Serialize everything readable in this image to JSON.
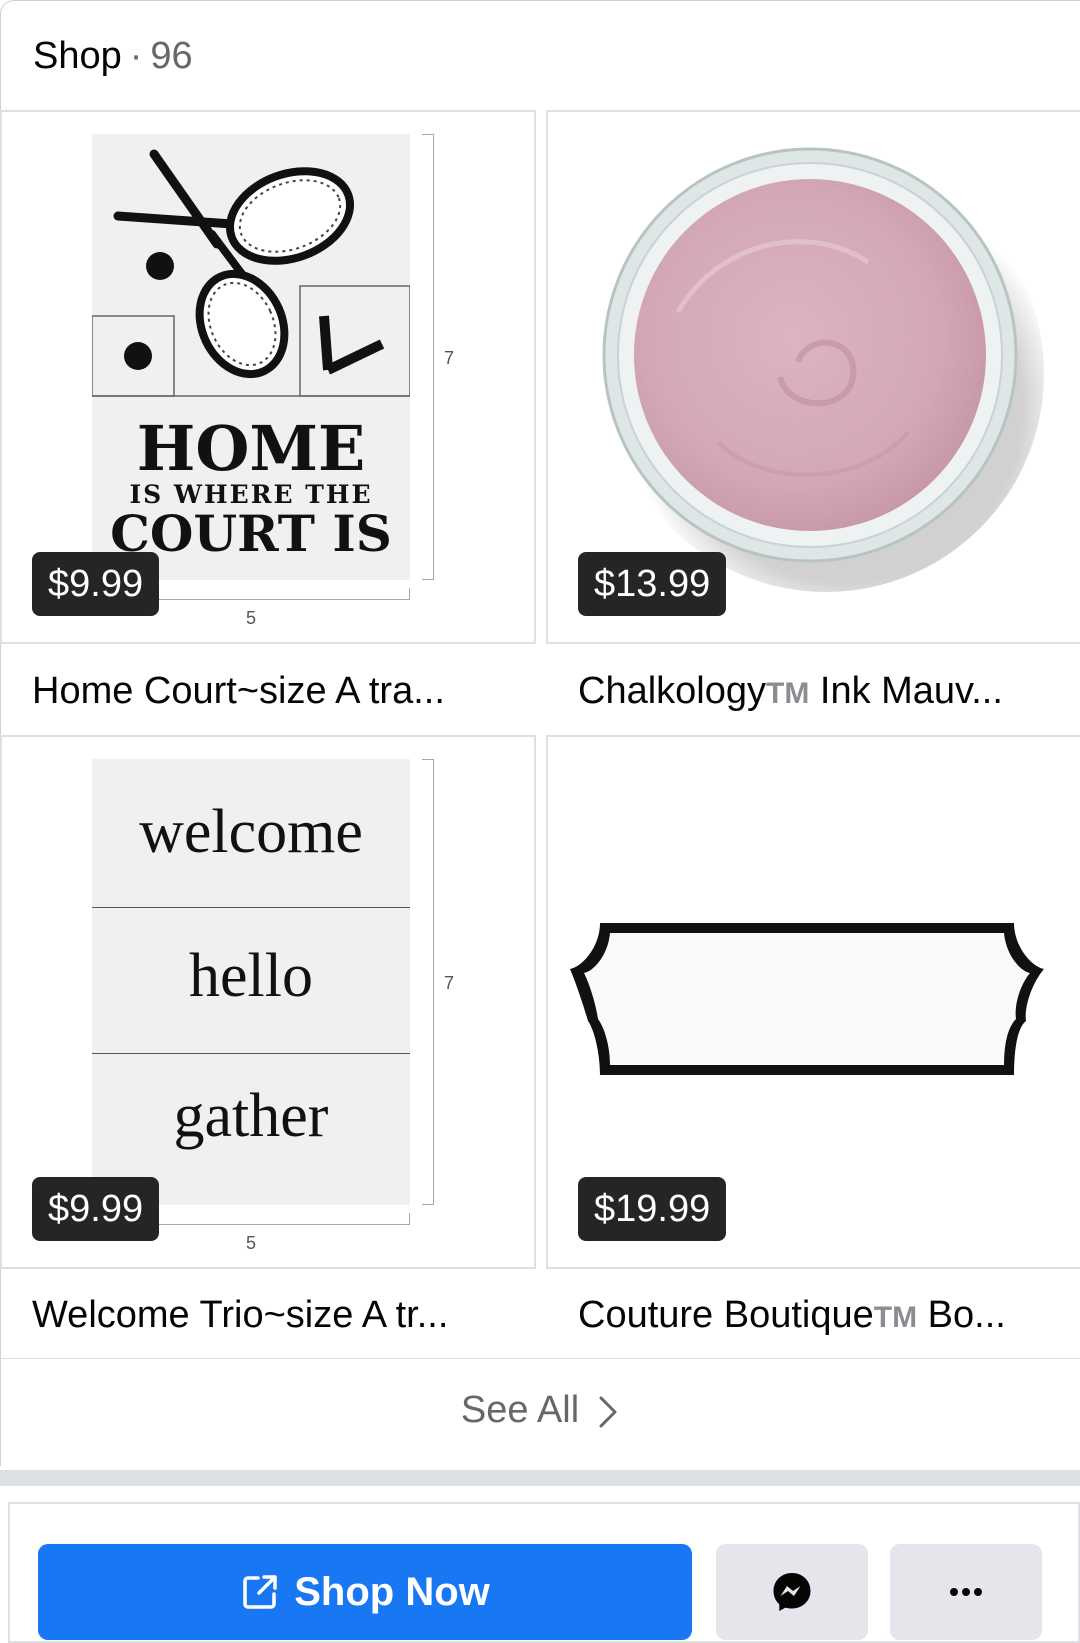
{
  "header": {
    "title": "Shop",
    "separator": "·",
    "count": "96"
  },
  "products": [
    {
      "name": "Home Court~size A tra...",
      "price": "$9.99"
    },
    {
      "name_before_tm": "Chalkology",
      "tm": "TM",
      "name_after_tm": " Ink Mauv...",
      "price": "$13.99"
    },
    {
      "name": "Welcome Trio~size A tr...",
      "price": "$9.99"
    },
    {
      "name_before_tm": "Couture Boutique",
      "tm": "TM",
      "name_after_tm": " Bo...",
      "price": "$19.99"
    }
  ],
  "stencil_home": {
    "line1": "HOME",
    "line2": "IS WHERE THE",
    "line3": "COURT IS",
    "dim_height": "7",
    "dim_width": "5"
  },
  "stencil_welcome": {
    "word1": "welcome",
    "word2": "hello",
    "word3": "gather",
    "dim_height": "7",
    "dim_width": "5"
  },
  "see_all": {
    "label": "See All"
  },
  "actions": {
    "shop_now": "Shop Now"
  },
  "colors": {
    "accent": "#1877f2",
    "price_badge": "#242526",
    "secondary_text": "#65676b",
    "mauve_ink": "#d3a9b9"
  },
  "icons": [
    "chevron-right-icon",
    "external-link-icon",
    "messenger-icon",
    "more-icon"
  ]
}
